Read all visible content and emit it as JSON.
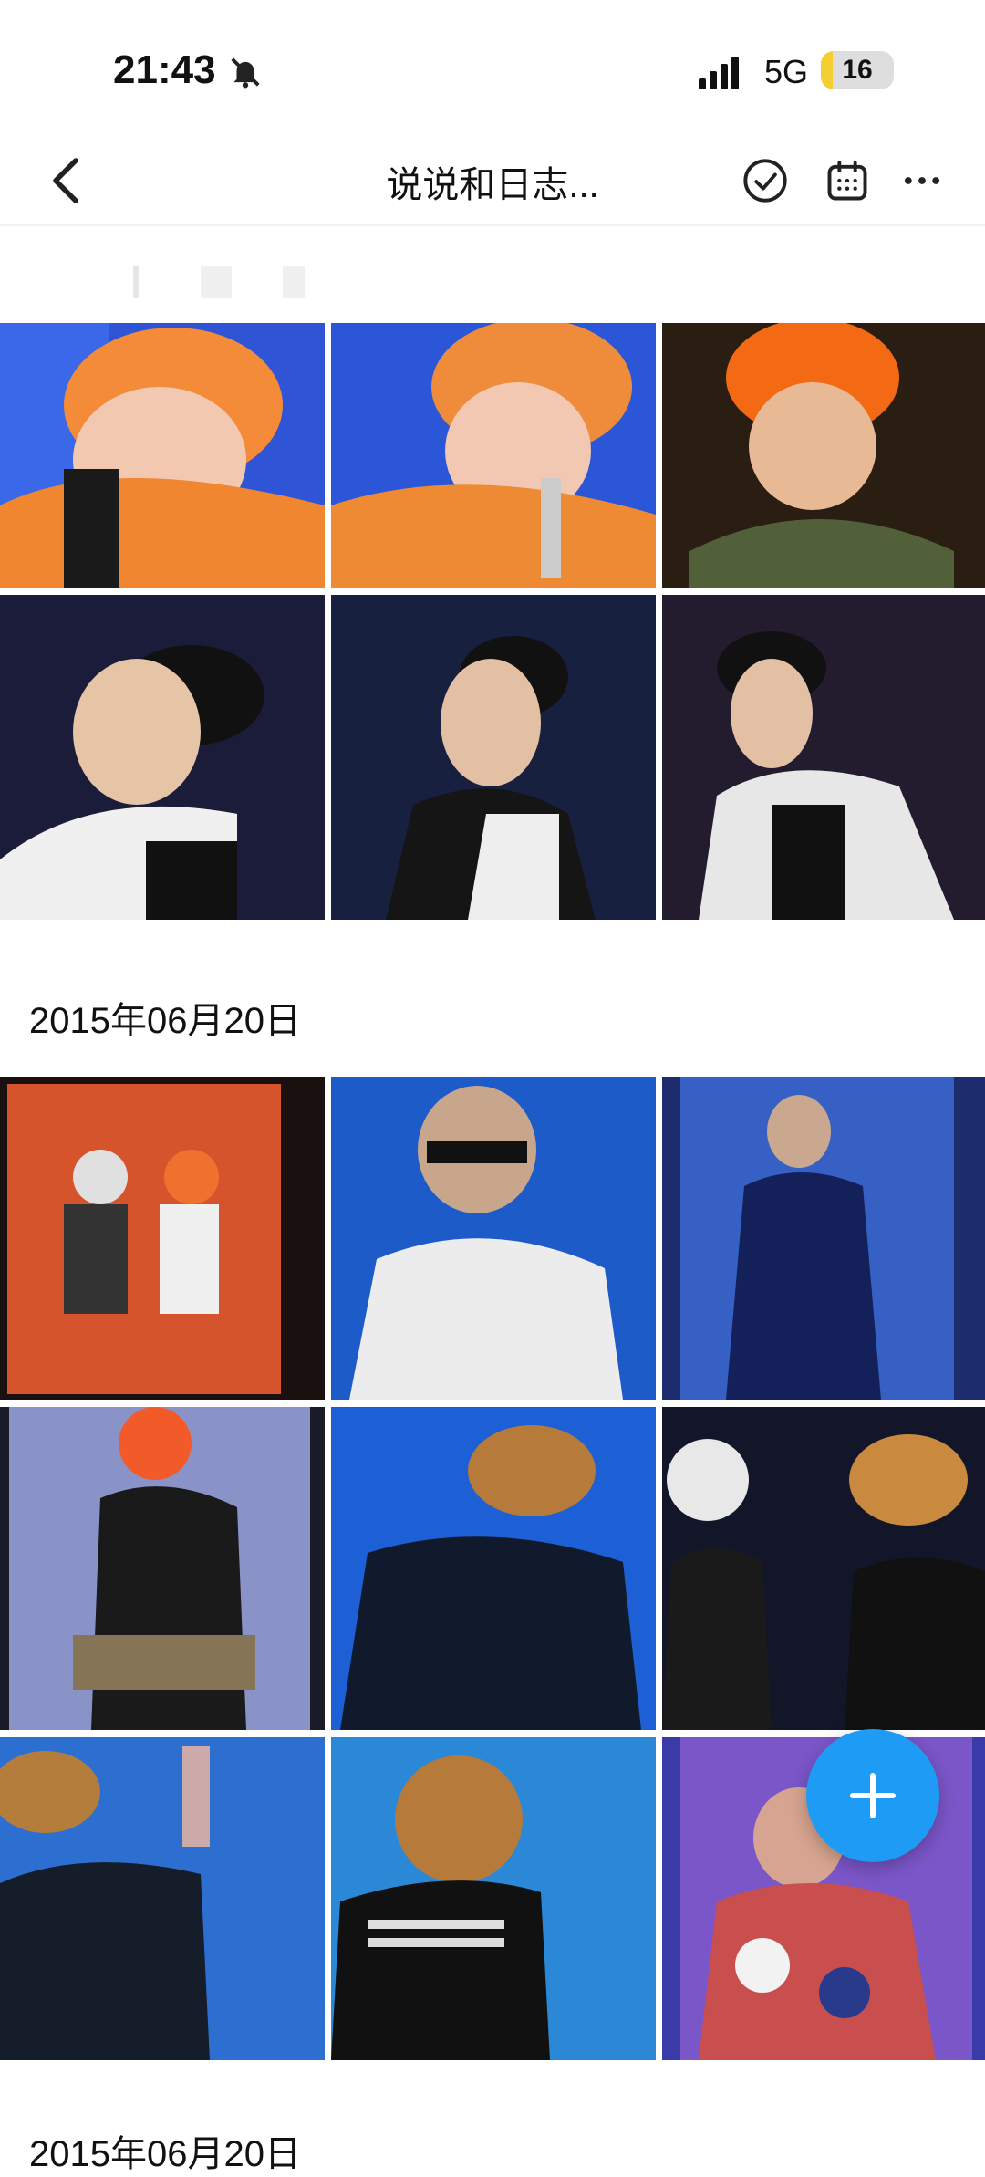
{
  "status_bar": {
    "time": "21:43",
    "network": "5G",
    "battery": "16",
    "battery_level": 0.16
  },
  "nav": {
    "title": "说说和日志...",
    "select_icon": "check-circle-icon",
    "calendar_icon": "calendar-icon",
    "more_icon": "more-dots-icon"
  },
  "sections": [
    {
      "date": "",
      "photo_count": 6
    },
    {
      "date": "2015年06月20日",
      "photo_count": 9
    },
    {
      "date": "2015年06月20日"
    }
  ],
  "fab": {
    "icon": "plus-icon"
  },
  "colors": {
    "accent": "#1e9bf5",
    "battery_fill": "#f5cf32"
  }
}
